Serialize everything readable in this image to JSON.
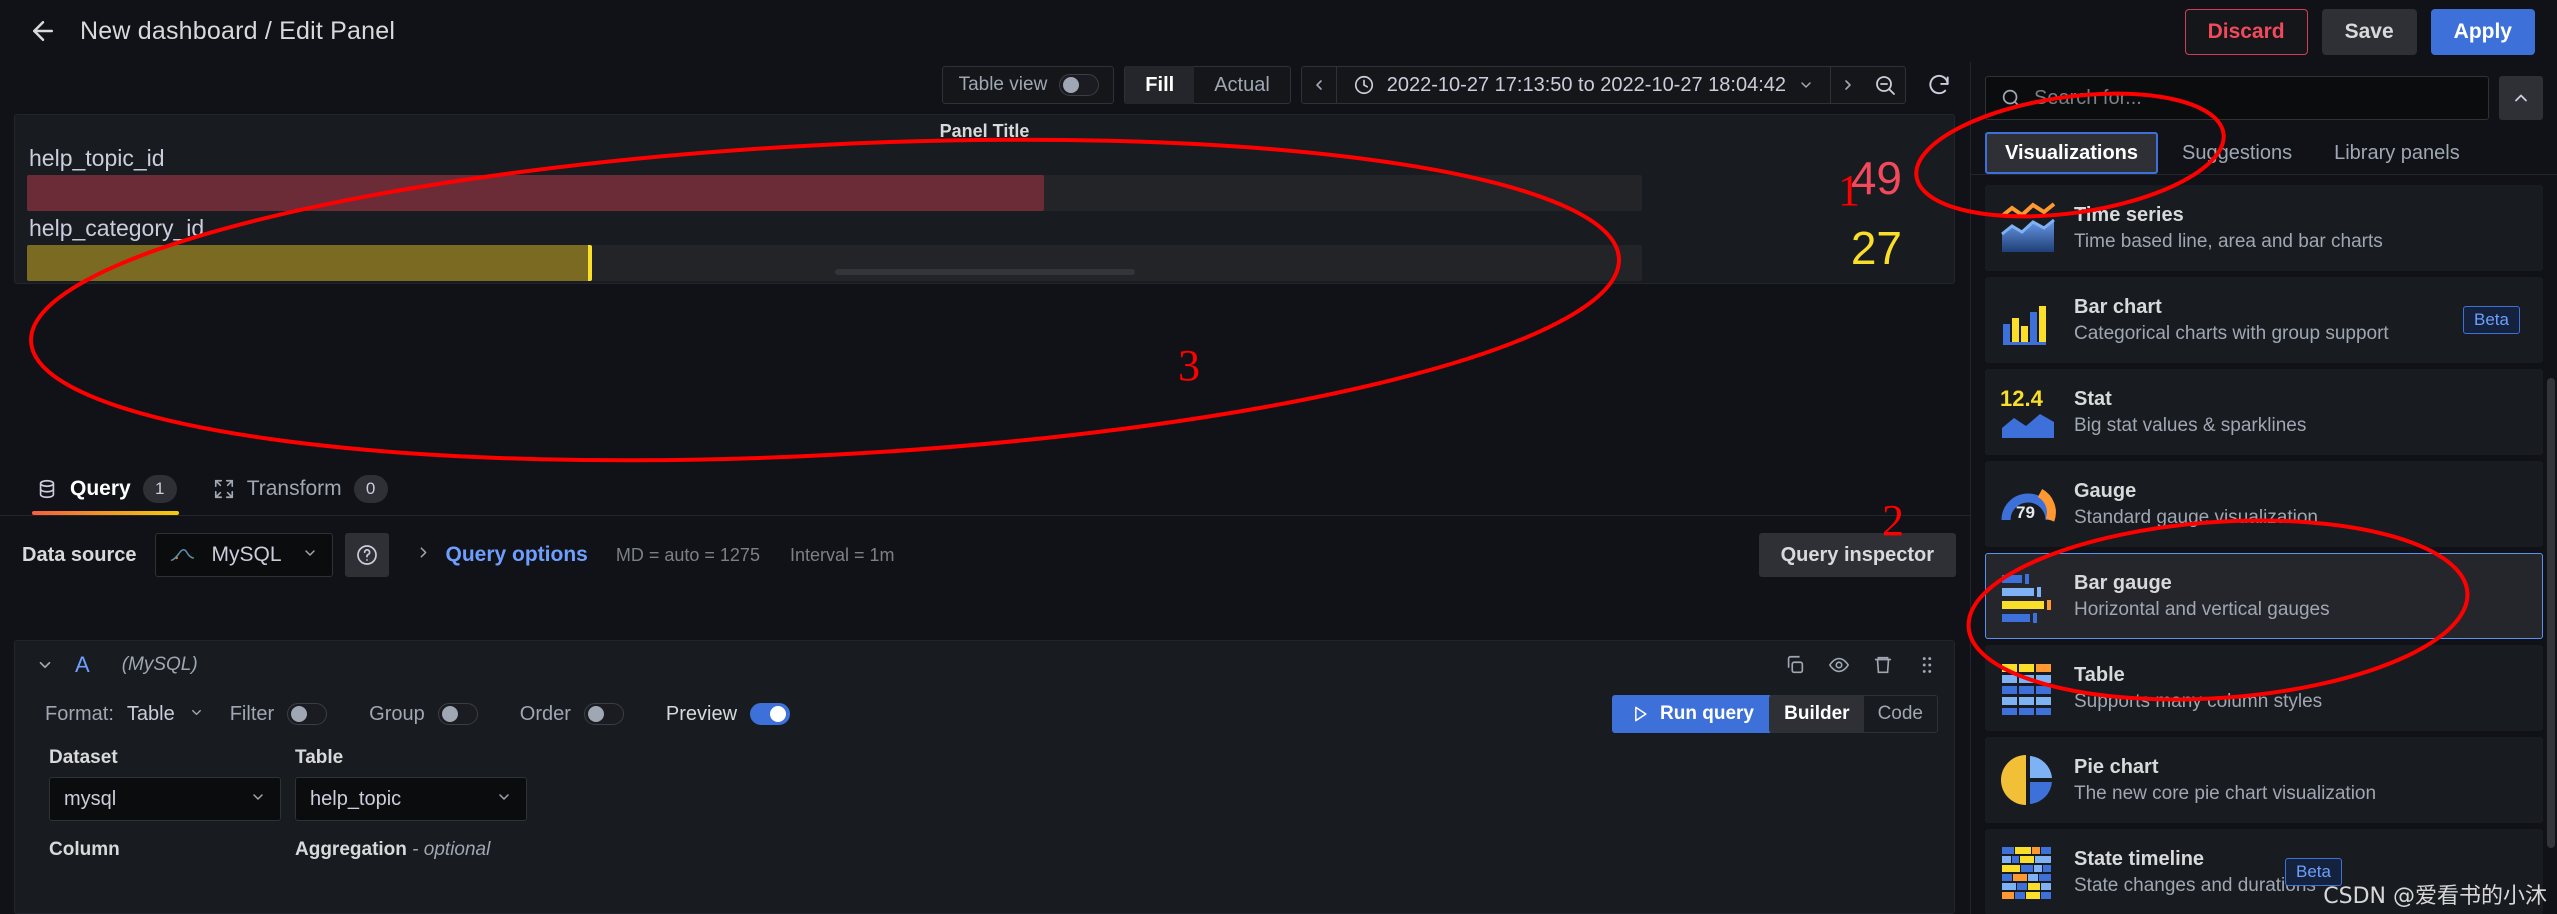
{
  "header": {
    "back_icon": "arrow-left-icon",
    "title": "New dashboard / Edit Panel",
    "discard_label": "Discard",
    "save_label": "Save",
    "apply_label": "Apply"
  },
  "toolbar": {
    "table_view_label": "Table view",
    "table_view_on": false,
    "fill_label": "Fill",
    "actual_label": "Actual",
    "fill_active": true,
    "time_range": "2022-10-27 17:13:50 to 2022-10-27 18:04:42",
    "clock_icon": "clock-icon",
    "prev_icon": "chevron-left-icon",
    "next_icon": "chevron-right-icon",
    "caret_icon": "chevron-down-icon",
    "zoom_out_icon": "zoom-out-icon",
    "refresh_icon": "refresh-icon"
  },
  "panel": {
    "title": "Panel Title",
    "bars": [
      {
        "label": "help_topic_id",
        "value": "49",
        "fill_pct": 63,
        "color": "#F2495C",
        "fill_color": "#6b2c38"
      },
      {
        "label": "help_category_id",
        "value": "27",
        "fill_pct": 35,
        "color": "#FADE2A",
        "fill_color": "#7b6b22"
      }
    ]
  },
  "query_tabs": {
    "query_label": "Query",
    "query_count": "1",
    "query_icon": "database-icon",
    "transform_label": "Transform",
    "transform_count": "0",
    "transform_icon": "transform-icon"
  },
  "datasource_row": {
    "label": "Data source",
    "name": "MySQL",
    "logo_icon": "mysql-logo-icon",
    "help_icon": "question-circle-icon",
    "query_options_label": "Query options",
    "expand_icon": "chevron-right-icon",
    "md_text": "MD = auto = 1275",
    "interval_text": "Interval = 1m",
    "query_inspector_label": "Query inspector"
  },
  "query_card": {
    "ref_id": "A",
    "ds_note": "(MySQL)",
    "collapse_icon": "chevron-down-icon",
    "copy_icon": "copy-icon",
    "eye_icon": "eye-icon",
    "trash_icon": "trash-icon",
    "drag_icon": "drag-handle-icon",
    "format_label": "Format:",
    "format_value": "Table",
    "filter_label": "Filter",
    "filter_on": false,
    "group_label": "Group",
    "group_on": false,
    "order_label": "Order",
    "order_on": false,
    "preview_label": "Preview",
    "preview_on": true,
    "run_query_label": "Run query",
    "run_icon": "play-icon",
    "builder_label": "Builder",
    "code_label": "Code",
    "builder_active": true,
    "dataset_label": "Dataset",
    "dataset_value": "mysql",
    "table_label": "Table",
    "table_value": "help_topic",
    "column_label": "Column",
    "aggregation_label": "Aggregation",
    "aggregation_optional": "- optional"
  },
  "sidebar": {
    "search_placeholder": "Search for...",
    "search_icon": "search-icon",
    "collapse_icon": "chevron-up-icon",
    "tabs": [
      {
        "label": "Visualizations",
        "active": true
      },
      {
        "label": "Suggestions",
        "active": false
      },
      {
        "label": "Library panels",
        "active": false
      }
    ],
    "items": [
      {
        "name": "Time series",
        "desc": "Time based line, area and bar charts",
        "icon": "time-series-icon",
        "beta": false,
        "selected": false
      },
      {
        "name": "Bar chart",
        "desc": "Categorical charts with group support",
        "icon": "bar-chart-icon",
        "beta": true,
        "beta_label": "Beta",
        "selected": false
      },
      {
        "name": "Stat",
        "desc": "Big stat values & sparklines",
        "icon": "stat-icon",
        "icon_text": "12.4",
        "beta": false,
        "selected": false
      },
      {
        "name": "Gauge",
        "desc": "Standard gauge visualization",
        "icon": "gauge-icon",
        "icon_text": "79",
        "beta": false,
        "selected": false
      },
      {
        "name": "Bar gauge",
        "desc": "Horizontal and vertical gauges",
        "icon": "bar-gauge-icon",
        "beta": false,
        "selected": true
      },
      {
        "name": "Table",
        "desc": "Supports many column styles",
        "icon": "table-icon",
        "beta": false,
        "selected": false
      },
      {
        "name": "Pie chart",
        "desc": "The new core pie chart visualization",
        "icon": "pie-chart-icon",
        "beta": false,
        "selected": false
      },
      {
        "name": "State timeline",
        "desc": "State changes and durations",
        "icon": "state-timeline-icon",
        "beta": true,
        "beta_label": "Beta",
        "selected": false
      }
    ]
  },
  "annotations": {
    "one": "1",
    "two": "2",
    "three": "3",
    "color": "#ff0000"
  },
  "watermark": "CSDN @爱看书的小沐"
}
